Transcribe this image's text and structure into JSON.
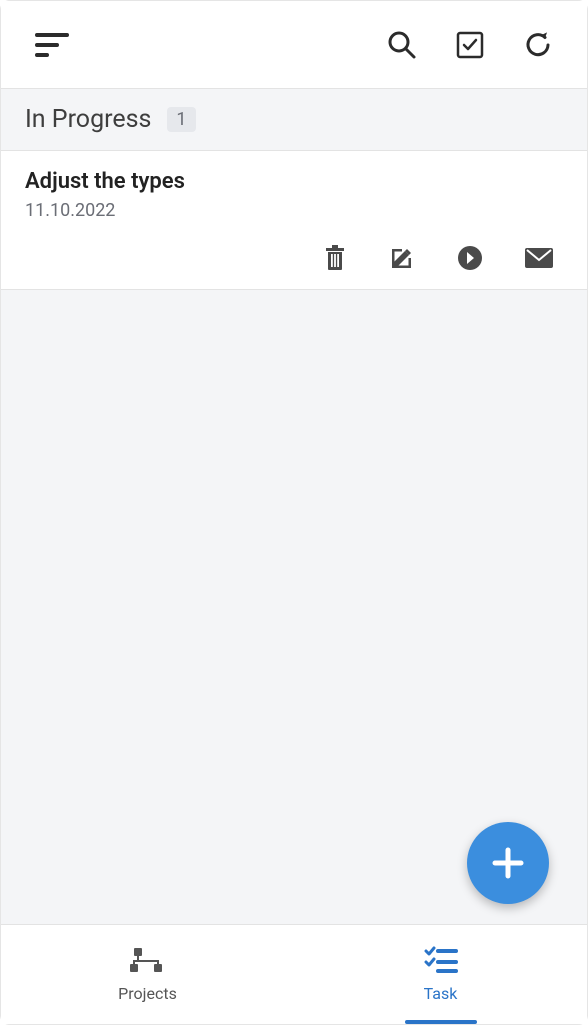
{
  "sectionHeader": {
    "title": "In Progress",
    "count": "1"
  },
  "tasks": [
    {
      "title": "Adjust the types",
      "date": "11.10.2022"
    }
  ],
  "nav": {
    "projects": {
      "label": "Projects"
    },
    "task": {
      "label": "Task"
    }
  },
  "colors": {
    "accent": "#2a74c8",
    "fab": "#3b8ede"
  }
}
